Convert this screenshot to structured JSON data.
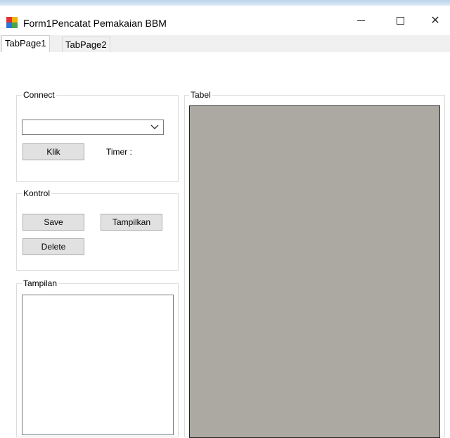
{
  "window": {
    "title": "Form1Pencatat Pemakaian BBM",
    "minimize_glyph": "–",
    "close_glyph": "✕"
  },
  "tabs": [
    {
      "label": "TabPage1",
      "active": true
    },
    {
      "label": "TabPage2",
      "active": false
    }
  ],
  "connect": {
    "title": "Connect",
    "combo_value": "",
    "klik_label": "Klik",
    "timer_label": "Timer :"
  },
  "kontrol": {
    "title": "Kontrol",
    "save_label": "Save",
    "tampilkan_label": "Tampilkan",
    "delete_label": "Delete"
  },
  "tampilan": {
    "title": "Tampilan",
    "text": ""
  },
  "tabel": {
    "title": "Tabel"
  },
  "colors": {
    "grid_background": "#aba9a1",
    "button_face": "#e1e1e1"
  }
}
